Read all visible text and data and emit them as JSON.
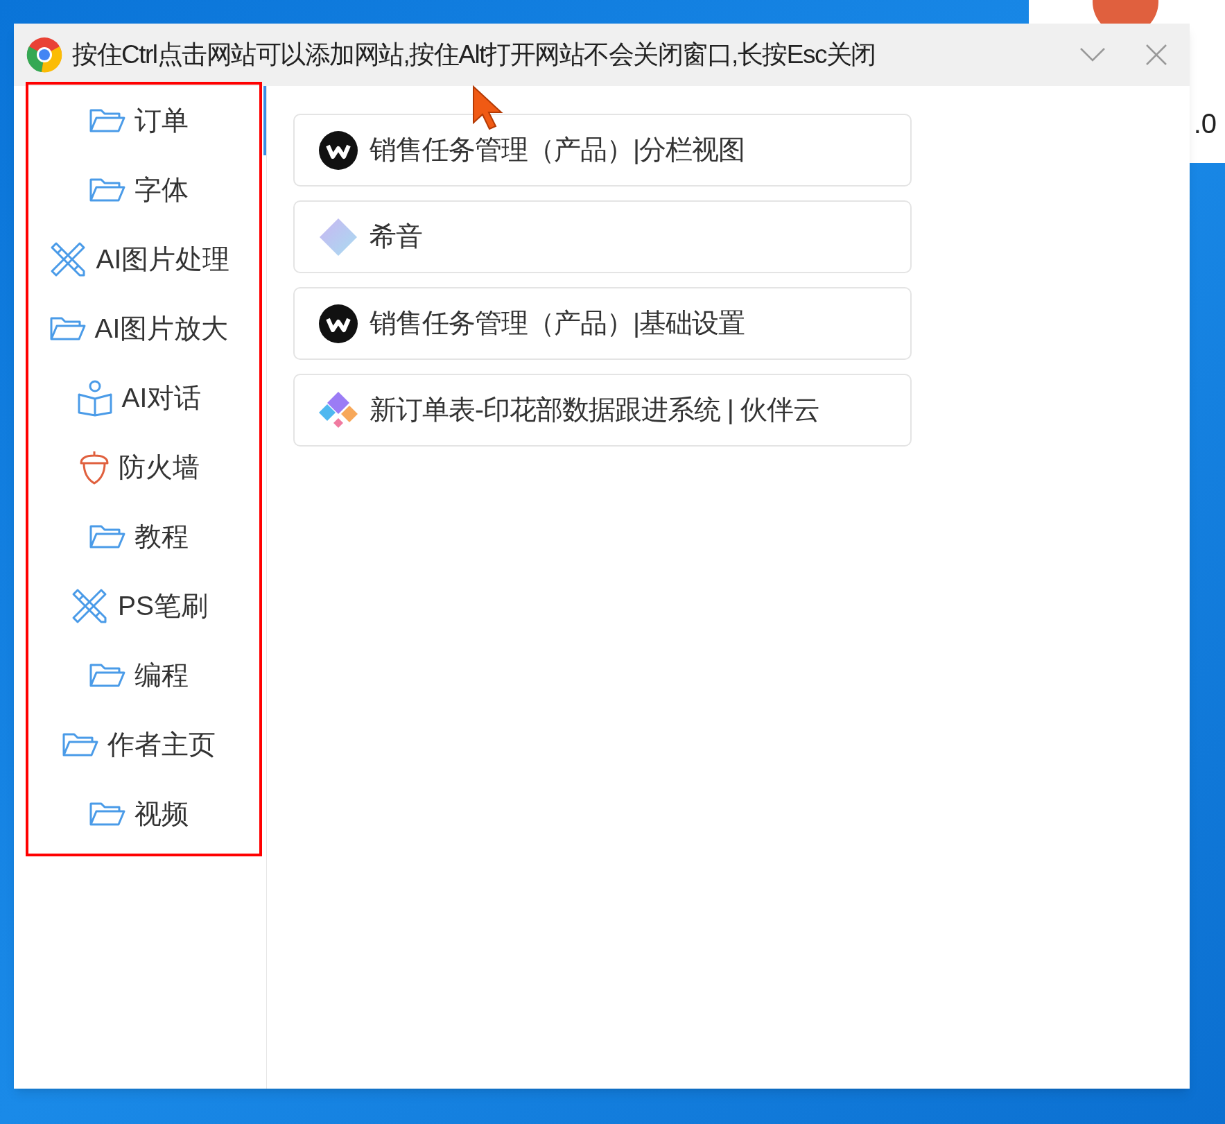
{
  "background_window": {
    "text": ".0"
  },
  "window": {
    "title": "按住Ctrl点击网站可以添加网站,按住Alt打开网站不会关闭窗口,长按Esc关闭"
  },
  "sidebar": {
    "items": [
      {
        "label": "订单",
        "kind": "folder",
        "selected": true
      },
      {
        "label": "字体",
        "kind": "folder",
        "selected": false
      },
      {
        "label": "AI图片处理",
        "kind": "tools",
        "selected": false
      },
      {
        "label": "AI图片放大",
        "kind": "folder",
        "selected": false
      },
      {
        "label": "AI对话",
        "kind": "reader",
        "selected": false
      },
      {
        "label": "防火墙",
        "kind": "acorn",
        "selected": false
      },
      {
        "label": "教程",
        "kind": "folder",
        "selected": false
      },
      {
        "label": "PS笔刷",
        "kind": "tools",
        "selected": false
      },
      {
        "label": "编程",
        "kind": "folder",
        "selected": false
      },
      {
        "label": "作者主页",
        "kind": "folder",
        "selected": false
      },
      {
        "label": "视频",
        "kind": "folder",
        "selected": false
      }
    ]
  },
  "sites": [
    {
      "title": "销售任务管理（产品）|分栏视图",
      "kind": "w-logo"
    },
    {
      "title": "希音",
      "kind": "diamond"
    },
    {
      "title": "销售任务管理（产品）|基础设置",
      "kind": "w-logo"
    },
    {
      "title": "新订单表-印花部数据跟进系统 | 伙伴云",
      "kind": "blocks"
    }
  ]
}
